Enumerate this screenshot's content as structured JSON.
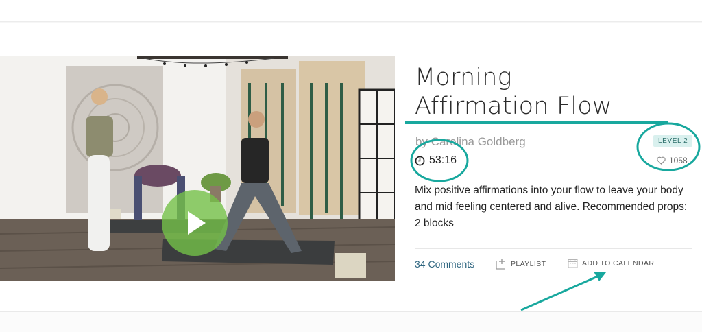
{
  "video": {
    "title": "Morning Affirmation Flow",
    "play_icon": "play-icon"
  },
  "details": {
    "title_line1": "Morning",
    "title_line2": "Affirmation Flow",
    "author": "by Carolina Goldberg",
    "duration": "53:16",
    "duration_icon": "clock-icon",
    "level": "LEVEL 2",
    "likes": "1058",
    "likes_icon": "heart-icon",
    "description": "Mix positive affirmations into your flow to leave your body and mid feeling centered and alive. Recommended props: 2 blocks"
  },
  "actions": {
    "comments": "34 Comments",
    "playlist_label": "PLAYLIST",
    "playlist_icon": "add-to-playlist-icon",
    "calendar_label": "ADD TO CALENDAR",
    "calendar_icon": "calendar-icon"
  },
  "colors": {
    "accent_teal": "#18a89e",
    "play_green": "#74c148",
    "level_badge_bg": "#d9f0ee",
    "link_blue": "#2f6680"
  }
}
